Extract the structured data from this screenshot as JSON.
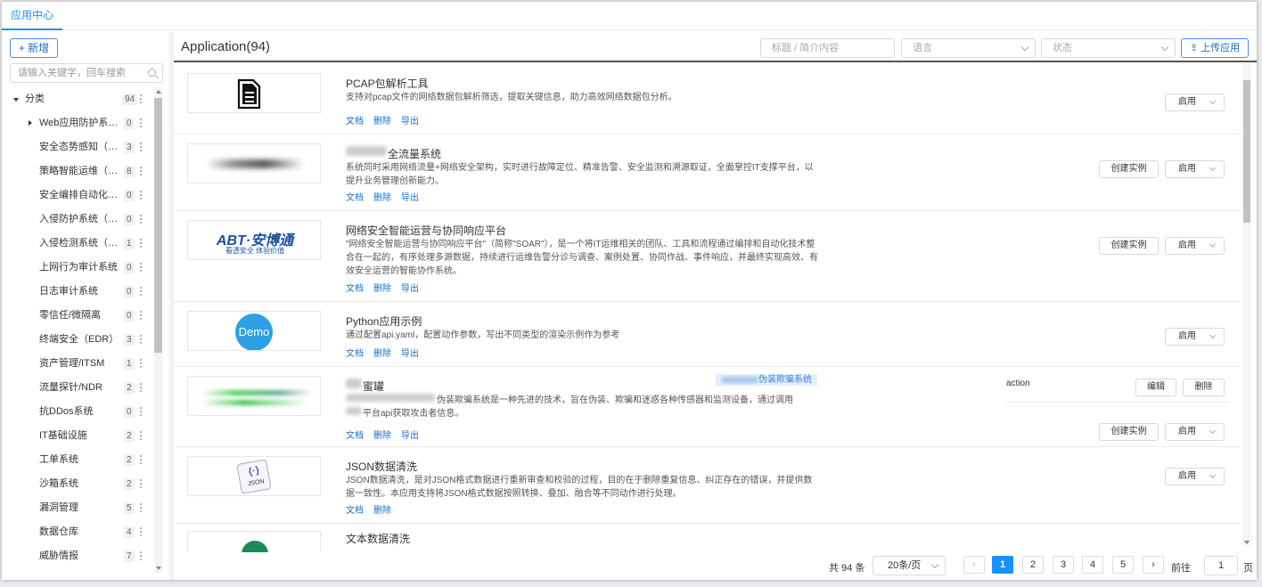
{
  "top_tab": "应用中心",
  "sidebar": {
    "new_button": "+ 新增",
    "search_placeholder": "请输入关键字，回车搜索",
    "root": {
      "label": "分类",
      "count": "94"
    },
    "items": [
      {
        "label": "Web应用防护系统…",
        "count": "0",
        "expandable": true
      },
      {
        "label": "安全态势感知（S…",
        "count": "3"
      },
      {
        "label": "策略智能运维（蟲…",
        "count": "8"
      },
      {
        "label": "安全编排自动化（…",
        "count": "0"
      },
      {
        "label": "入侵防护系统（IP…",
        "count": "0"
      },
      {
        "label": "入侵检测系统（ID…",
        "count": "1"
      },
      {
        "label": "上网行为审计系统",
        "count": "0"
      },
      {
        "label": "日志审计系统",
        "count": "0"
      },
      {
        "label": "零信任/微隔离",
        "count": "0"
      },
      {
        "label": "终端安全（EDR）",
        "count": "3"
      },
      {
        "label": "资产管理/ITSM",
        "count": "1"
      },
      {
        "label": "流量探针/NDR",
        "count": "2"
      },
      {
        "label": "抗DDos系统",
        "count": "0"
      },
      {
        "label": "IT基础设施",
        "count": "2"
      },
      {
        "label": "工单系统",
        "count": "2"
      },
      {
        "label": "沙箱系统",
        "count": "2"
      },
      {
        "label": "漏洞管理",
        "count": "5"
      },
      {
        "label": "数据仓库",
        "count": "4"
      },
      {
        "label": "威胁情报",
        "count": "7"
      }
    ]
  },
  "header": {
    "title": "Application(94)",
    "filter_title_placeholder": "标题 / 简介内容",
    "filter_lang_placeholder": "语言",
    "filter_status_placeholder": "状态",
    "upload_button": "上传应用"
  },
  "labels": {
    "doc": "文档",
    "delete": "删除",
    "export": "导出",
    "create_instance": "创建实例",
    "enable": "启用",
    "edit": "编辑",
    "action": "action"
  },
  "apps": [
    {
      "name": "PCAP包解析工具",
      "desc": "支持对pcap文件的网络数据包解析筛选，提取关键信息，助力高效网络数据包分析。"
    },
    {
      "name": "全流量系统",
      "desc": "系统同时采用网络流量+网络安全架构，实时进行故障定位、精准告警、安全监测和溯源取证，全面掌控IT支撑平台，以提升业务管理创新能力。"
    },
    {
      "name": "网络安全智能运营与协同响应平台",
      "desc": "\"网络安全智能运营与协同响应平台\"（简称\"SOAR\"），是一个将IT运维相关的团队、工具和流程通过编排和自动化技术整合在一起的，有序处理多源数据，持续进行运维告警分诊与调查、案例处置、协同作战、事件响应，并最终实现高效、有效安全运营的智能协作系统。",
      "logo_text": "ABT·安博通",
      "logo_sub": "看透安全 体验价值"
    },
    {
      "name": "Python应用示例",
      "desc": "通过配置api.yaml，配置动作参数，写出不同类型的渲染示例作为参考",
      "logo_text": "Demo"
    },
    {
      "name": "蜜罐",
      "desc_mid": "伪装欺骗系统是一种先进的技术，旨在伪装、欺骗和迷惑各种传感器和监测设备，通过调用",
      "desc_tail": "平台api获取攻击者信息。",
      "tag": "伪装欺骗系统"
    },
    {
      "name": "JSON数据清洗",
      "desc": "JSON数据清洗，是对JSON格式数据进行重新审查和校验的过程，目的在于删除重复信息、纠正存在的错误，并提供数据一致性。本应用支持将JSON格式数据按照转换、叠加、融合等不同动作进行处理。",
      "logo_text": "JSON"
    },
    {
      "name": "文本数据清洗"
    }
  ],
  "pager": {
    "total": "共 94 条",
    "page_size": "20条/页",
    "pages": [
      "1",
      "2",
      "3",
      "4",
      "5"
    ],
    "current": "1",
    "goto_label": "前往",
    "goto_value": "1",
    "goto_unit": "页"
  }
}
